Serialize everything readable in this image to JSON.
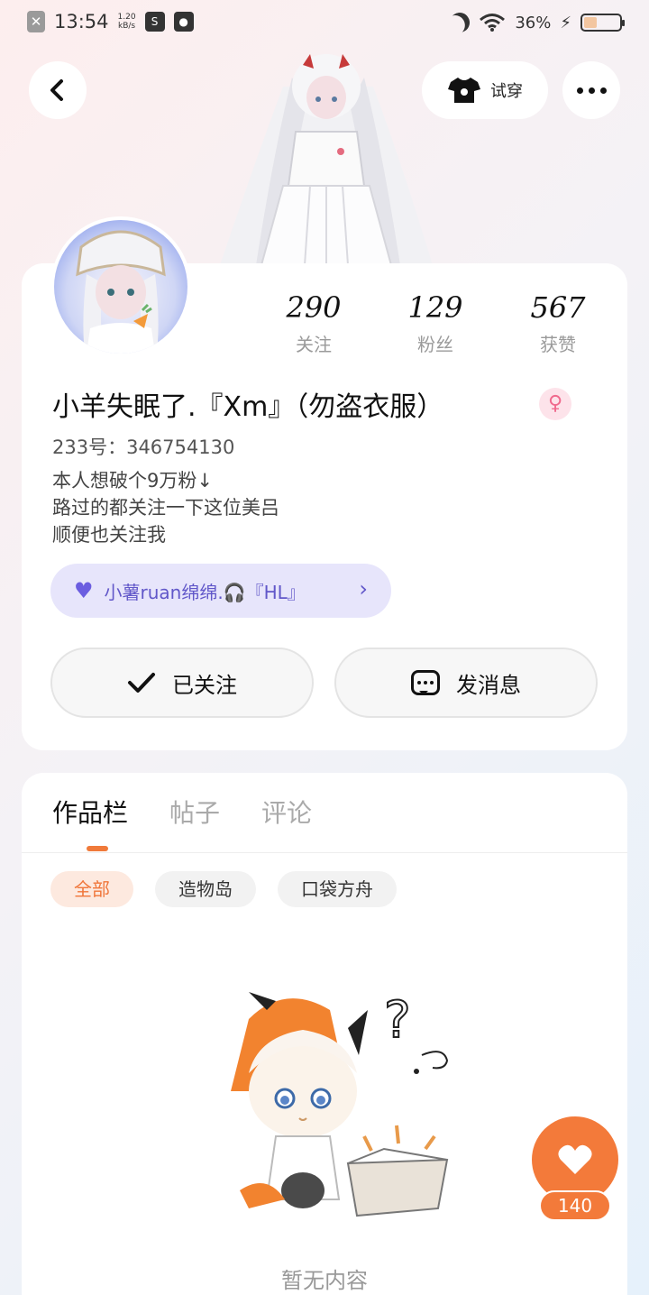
{
  "status_bar": {
    "time": "13:54",
    "speed": "1.20",
    "speed_unit": "kB/s",
    "battery_percent": "36%",
    "battery_level": 0.36
  },
  "header": {
    "try_on_label": "试穿"
  },
  "profile": {
    "stats": [
      {
        "value": "290",
        "label": "关注"
      },
      {
        "value": "129",
        "label": "粉丝"
      },
      {
        "value": "567",
        "label": "获赞"
      }
    ],
    "nickname": "小羊失眠了.『Xm』（勿盗衣服）",
    "uid": "233号：346754130",
    "bio": [
      "本人想破个9万粉↓",
      "路过的都关注一下这位美吕",
      "顺便也关注我"
    ],
    "badge_text": "小薯ruan绵绵.🎧『HL』",
    "follow_label": "已关注",
    "message_label": "发消息"
  },
  "works": {
    "tabs": [
      "作品栏",
      "帖子",
      "评论"
    ],
    "filters": [
      "全部",
      "造物岛",
      "口袋方舟"
    ],
    "empty_text": "暂无内容"
  },
  "like": {
    "count": "140"
  },
  "colors": {
    "accent": "#f37a3a",
    "badge_bg": "#e7e5fb",
    "badge_text": "#6157c9"
  }
}
